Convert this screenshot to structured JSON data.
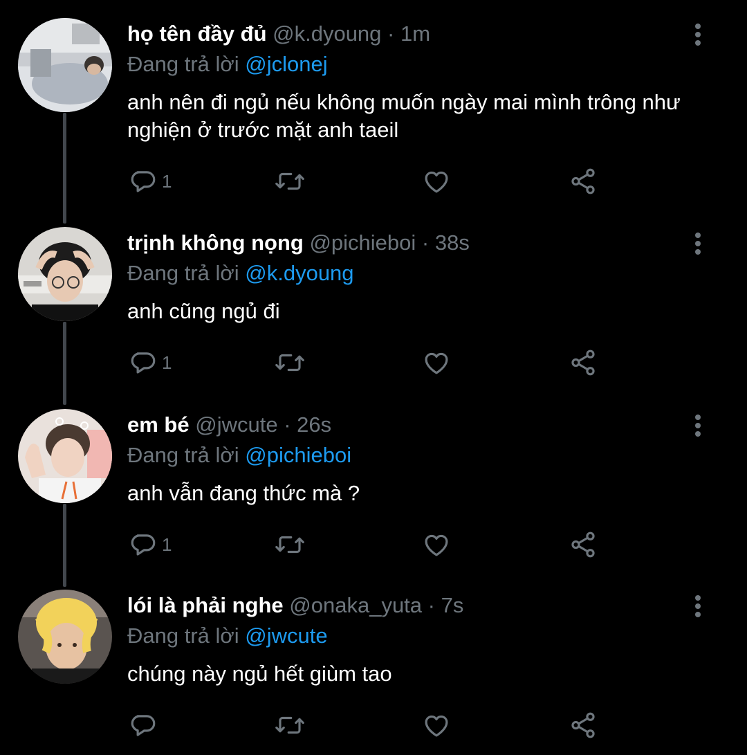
{
  "reply_prefix": "Đang trả lời",
  "colors": {
    "background": "#000000",
    "muted": "#6e767d",
    "link": "#1d9bf0",
    "thread_line": "#42474d"
  },
  "icons": {
    "reply": "reply-bubble-icon",
    "retweet": "retweet-icon",
    "like": "heart-icon",
    "share": "share-icon",
    "more": "more-vertical-icon"
  },
  "tweets": [
    {
      "name": "họ tên đầy đủ",
      "handle": "@k.dyoung",
      "time": "1m",
      "reply_to": "@jclonej",
      "text": "anh nên đi ngủ nếu không muốn ngày mai mình trông như nghiện ở trước mặt anh taeil",
      "reply_count": "1"
    },
    {
      "name": "trịnh không nọng",
      "handle": "@pichieboi",
      "time": "38s",
      "reply_to": "@k.dyoung",
      "text": "anh cũng ngủ đi",
      "reply_count": "1"
    },
    {
      "name": "em bé",
      "handle": "@jwcute",
      "time": "26s",
      "reply_to": "@pichieboi",
      "text": "anh vẫn đang thức mà ?",
      "reply_count": "1"
    },
    {
      "name": "lói là phải nghe",
      "handle": "@onaka_yuta",
      "time": "7s",
      "reply_to": "@jwcute",
      "text": "chúng này ngủ hết giùm tao",
      "reply_count": ""
    }
  ]
}
